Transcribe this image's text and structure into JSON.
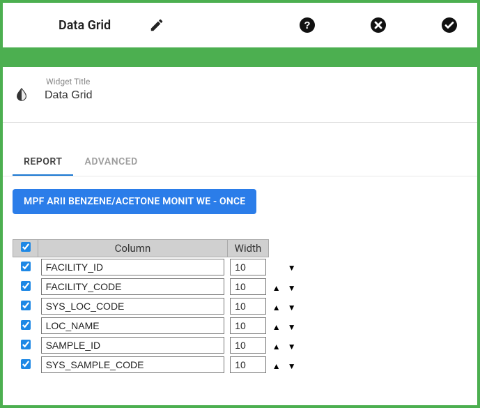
{
  "topbar": {
    "title": "Data Grid"
  },
  "widget": {
    "field_label": "Widget Title",
    "title_value": "Data Grid"
  },
  "tabs": {
    "report": "REPORT",
    "advanced": "ADVANCED"
  },
  "chip": "MPF ARII BENZENE/ACETONE MONIT WE - ONCE",
  "grid": {
    "head_column": "Column",
    "head_width": "Width",
    "rows": [
      {
        "checked": true,
        "column": "FACILITY_ID",
        "width": "10",
        "up": false,
        "down": true
      },
      {
        "checked": true,
        "column": "FACILITY_CODE",
        "width": "10",
        "up": true,
        "down": true
      },
      {
        "checked": true,
        "column": "SYS_LOC_CODE",
        "width": "10",
        "up": true,
        "down": true
      },
      {
        "checked": true,
        "column": "LOC_NAME",
        "width": "10",
        "up": true,
        "down": true
      },
      {
        "checked": true,
        "column": "SAMPLE_ID",
        "width": "10",
        "up": true,
        "down": true
      },
      {
        "checked": true,
        "column": "SYS_SAMPLE_CODE",
        "width": "10",
        "up": true,
        "down": true
      }
    ]
  }
}
